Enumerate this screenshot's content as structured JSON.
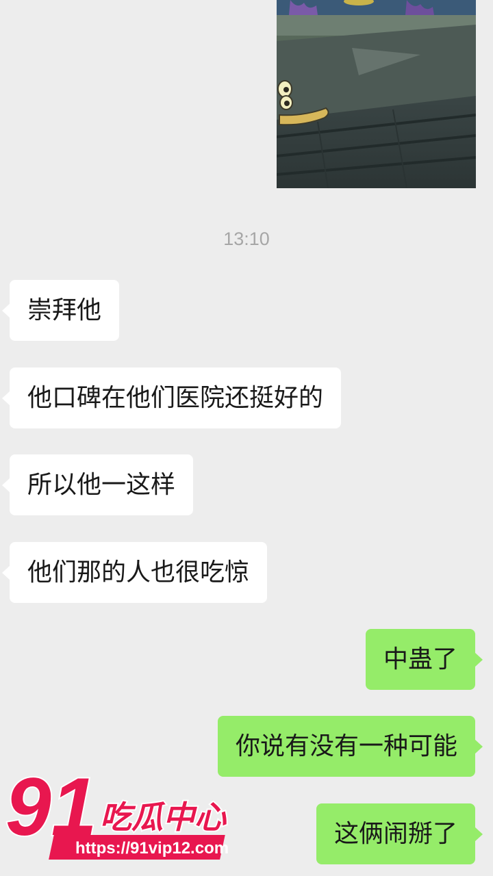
{
  "chat": {
    "timestamp": "13:10",
    "messages": [
      {
        "side": "in",
        "text": "崇拜他"
      },
      {
        "side": "in",
        "text": "他口碑在他们医院还挺好的"
      },
      {
        "side": "in",
        "text": "所以他一这样"
      },
      {
        "side": "in",
        "text": "他们那的人也很吃惊"
      },
      {
        "side": "out",
        "text": "中蛊了"
      },
      {
        "side": "out",
        "text": "你说有没有一种可能"
      },
      {
        "side": "out",
        "text": "这俩闹掰了"
      }
    ]
  },
  "watermark": {
    "number": "91",
    "title": "吃瓜中心",
    "url": "https://91vip12.com"
  },
  "colors": {
    "background": "#ededed",
    "incoming_bubble": "#ffffff",
    "outgoing_bubble": "#95ec69",
    "watermark_brand": "#e8174f"
  }
}
